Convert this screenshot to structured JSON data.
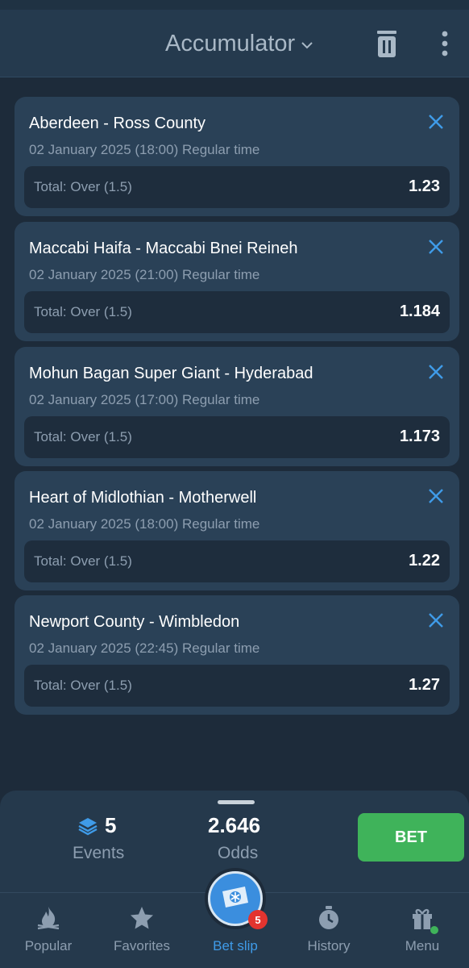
{
  "header": {
    "title": "Accumulator"
  },
  "bets": [
    {
      "match": "Aberdeen - Ross County",
      "date": "02 January 2025 (18:00) Regular time",
      "market": "Total: Over (1.5)",
      "odds": "1.23"
    },
    {
      "match": "Maccabi Haifa - Maccabi Bnei Reineh",
      "date": "02 January 2025 (21:00) Regular time",
      "market": "Total: Over (1.5)",
      "odds": "1.184"
    },
    {
      "match": "Mohun Bagan Super Giant - Hyderabad",
      "date": "02 January 2025 (17:00) Regular time",
      "market": "Total: Over (1.5)",
      "odds": "1.173"
    },
    {
      "match": "Heart of Midlothian - Motherwell",
      "date": "02 January 2025 (18:00) Regular time",
      "market": "Total: Over (1.5)",
      "odds": "1.22"
    },
    {
      "match": "Newport County - Wimbledon",
      "date": "02 January 2025 (22:45) Regular time",
      "market": "Total: Over (1.5)",
      "odds": "1.27"
    }
  ],
  "summary": {
    "events_count": "5",
    "events_label": "Events",
    "odds_value": "2.646",
    "odds_label": "Odds",
    "bet_label": "BET"
  },
  "nav": {
    "popular": "Popular",
    "favorites": "Favorites",
    "betslip": "Bet slip",
    "betslip_badge": "5",
    "history": "History",
    "menu": "Menu"
  },
  "colors": {
    "background": "#1d2b3a",
    "card": "#2a4157",
    "accent_blue": "#3f9be8",
    "bet_green": "#3fb35a",
    "badge_red": "#e3342f"
  },
  "icons": {
    "trash": "trash-icon",
    "kebab": "kebab-menu-icon",
    "close": "close-icon",
    "layers": "layers-icon",
    "fire": "fire-icon",
    "star": "star-icon",
    "ticket": "ticket-icon",
    "clock": "stopwatch-icon",
    "gift": "gift-icon"
  }
}
